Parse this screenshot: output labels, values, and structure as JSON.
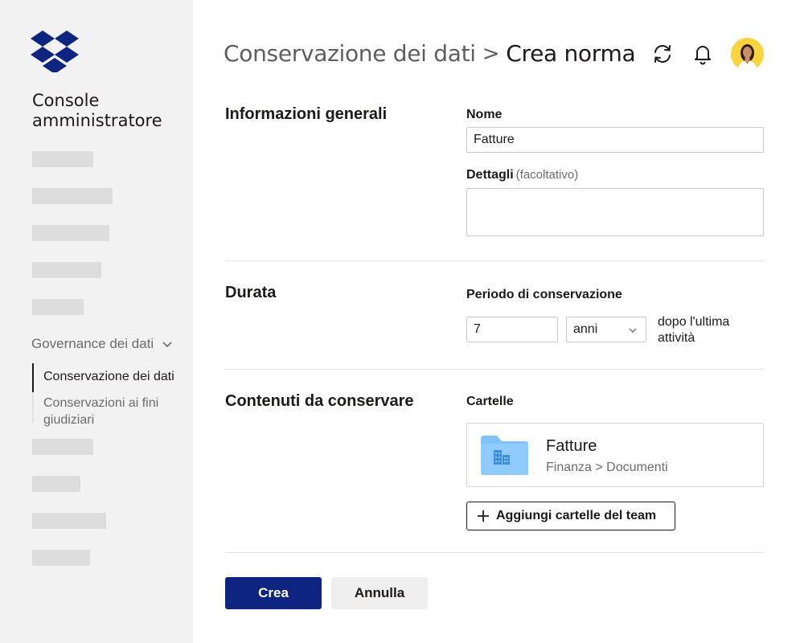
{
  "sidebar": {
    "title": "Console amministratore",
    "group_label": "Governance dei dati",
    "subnav": [
      {
        "label": "Conservazione dei dati",
        "active": true
      },
      {
        "label": "Conservazioni ai fini giudiziari",
        "active": false
      }
    ],
    "logo_icon": "dropbox-logo"
  },
  "header": {
    "breadcrumb_parent": "Conservazione dei dati",
    "breadcrumb_separator": ">",
    "breadcrumb_current": "Crea norma",
    "icons": [
      "sync-icon",
      "bell-icon",
      "avatar"
    ]
  },
  "general": {
    "section_title": "Informazioni generali",
    "name_label": "Nome",
    "name_value": "Fatture",
    "details_label": "Dettagli",
    "details_optional": "(facoltativo)",
    "details_value": ""
  },
  "duration": {
    "section_title": "Durata",
    "period_label": "Periodo di conservazione",
    "period_value": "7",
    "unit_value": "anni",
    "after_text": "dopo l'ultima attività"
  },
  "content": {
    "section_title": "Contenuti da conservare",
    "folders_label": "Cartelle",
    "folder": {
      "name": "Fatture",
      "path": "Finanza > Documenti"
    },
    "add_button": "Aggiungi cartelle del team"
  },
  "actions": {
    "create": "Crea",
    "cancel": "Annulla"
  },
  "colors": {
    "primary": "#0d2481",
    "sidebar_bg": "#f2f2f2",
    "logo": "#0d2481",
    "folder": "#7fc2fb",
    "avatar_bg": "#fbd43d"
  }
}
